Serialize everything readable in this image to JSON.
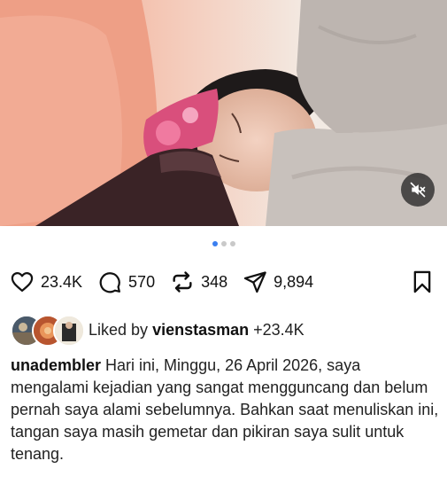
{
  "post": {
    "media": {
      "description": "video-frame",
      "carousel_count": 3,
      "carousel_active_index": 0,
      "mute_icon": "speaker-muted-icon"
    },
    "actions": {
      "like_count": "23.4K",
      "comment_count": "570",
      "repost_count": "348",
      "share_count": "9,894"
    },
    "liked_by": {
      "prefix": "Liked by",
      "username": "vienstasman",
      "suffix": "+23.4K"
    },
    "caption": {
      "username": "unadembler",
      "text": "Hari ini, Minggu, 26 April 2026, saya mengalami kejadian yang sangat mengguncang dan belum pernah saya alami sebelumnya. Bahkan saat menuliskan ini, tangan saya masih gemetar dan pikiran saya sulit untuk tenang."
    },
    "colors": {
      "accent_dot": "#3b7ff0",
      "mask_pink": "#d94f7c",
      "blanket": "#c8c1bc"
    }
  }
}
